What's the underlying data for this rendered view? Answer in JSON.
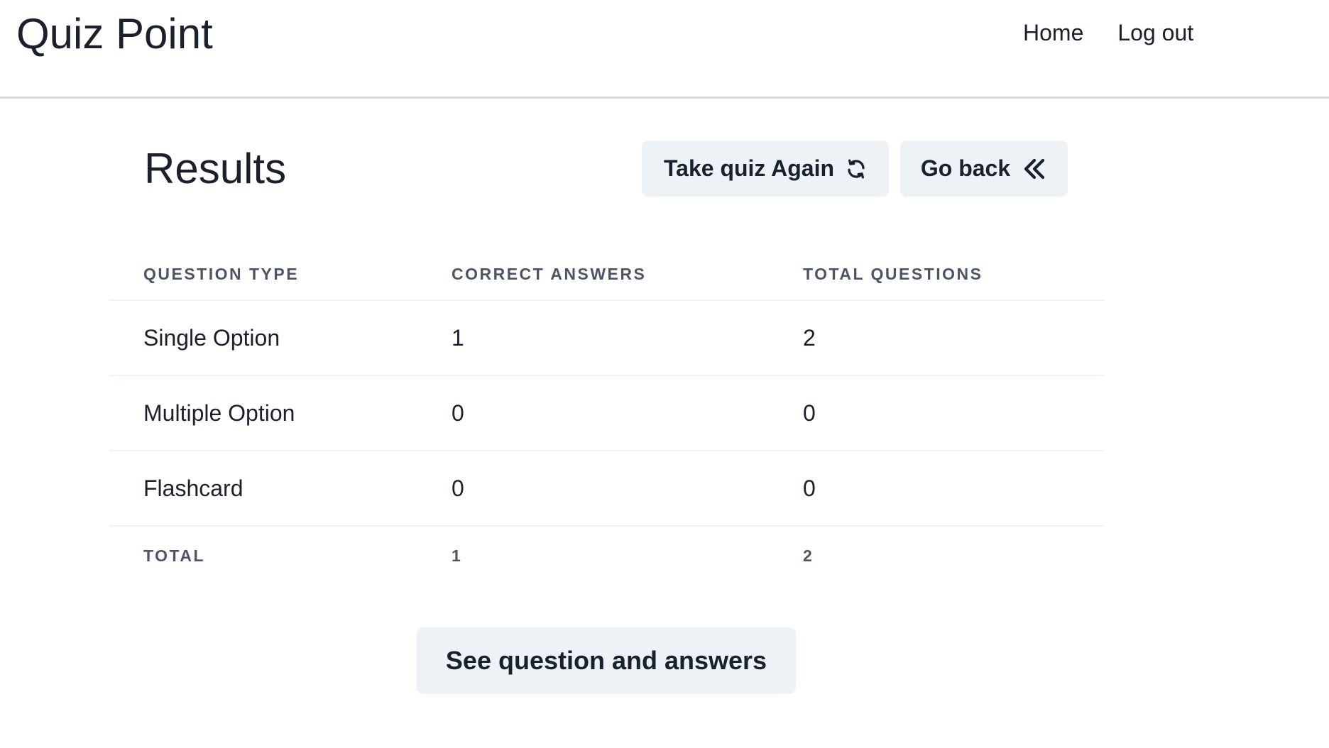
{
  "app": {
    "title": "Quiz Point"
  },
  "nav": {
    "items": [
      {
        "label": "Home"
      },
      {
        "label": "Log out"
      }
    ]
  },
  "main": {
    "title": "Results",
    "buttons": {
      "retake_label": "Take quiz Again",
      "retake_icon": "refresh-icon",
      "back_label": "Go back",
      "back_icon": "double-chevron-left-icon",
      "see_answers_label": "See question and answers"
    },
    "table": {
      "headers": [
        "QUESTION TYPE",
        "CORRECT ANSWERS",
        "TOTAL QUESTIONS"
      ],
      "rows": [
        {
          "type": "Single Option",
          "correct": "1",
          "total": "2"
        },
        {
          "type": "Multiple Option",
          "correct": "0",
          "total": "0"
        },
        {
          "type": "Flashcard",
          "correct": "0",
          "total": "0"
        }
      ],
      "footer": {
        "type": "TOTAL",
        "correct": "1",
        "total": "2"
      }
    }
  },
  "colors": {
    "text": "#1a202c",
    "muted": "#4a5568",
    "button_bg": "#edf2f7",
    "divider": "#d6d6d6"
  }
}
